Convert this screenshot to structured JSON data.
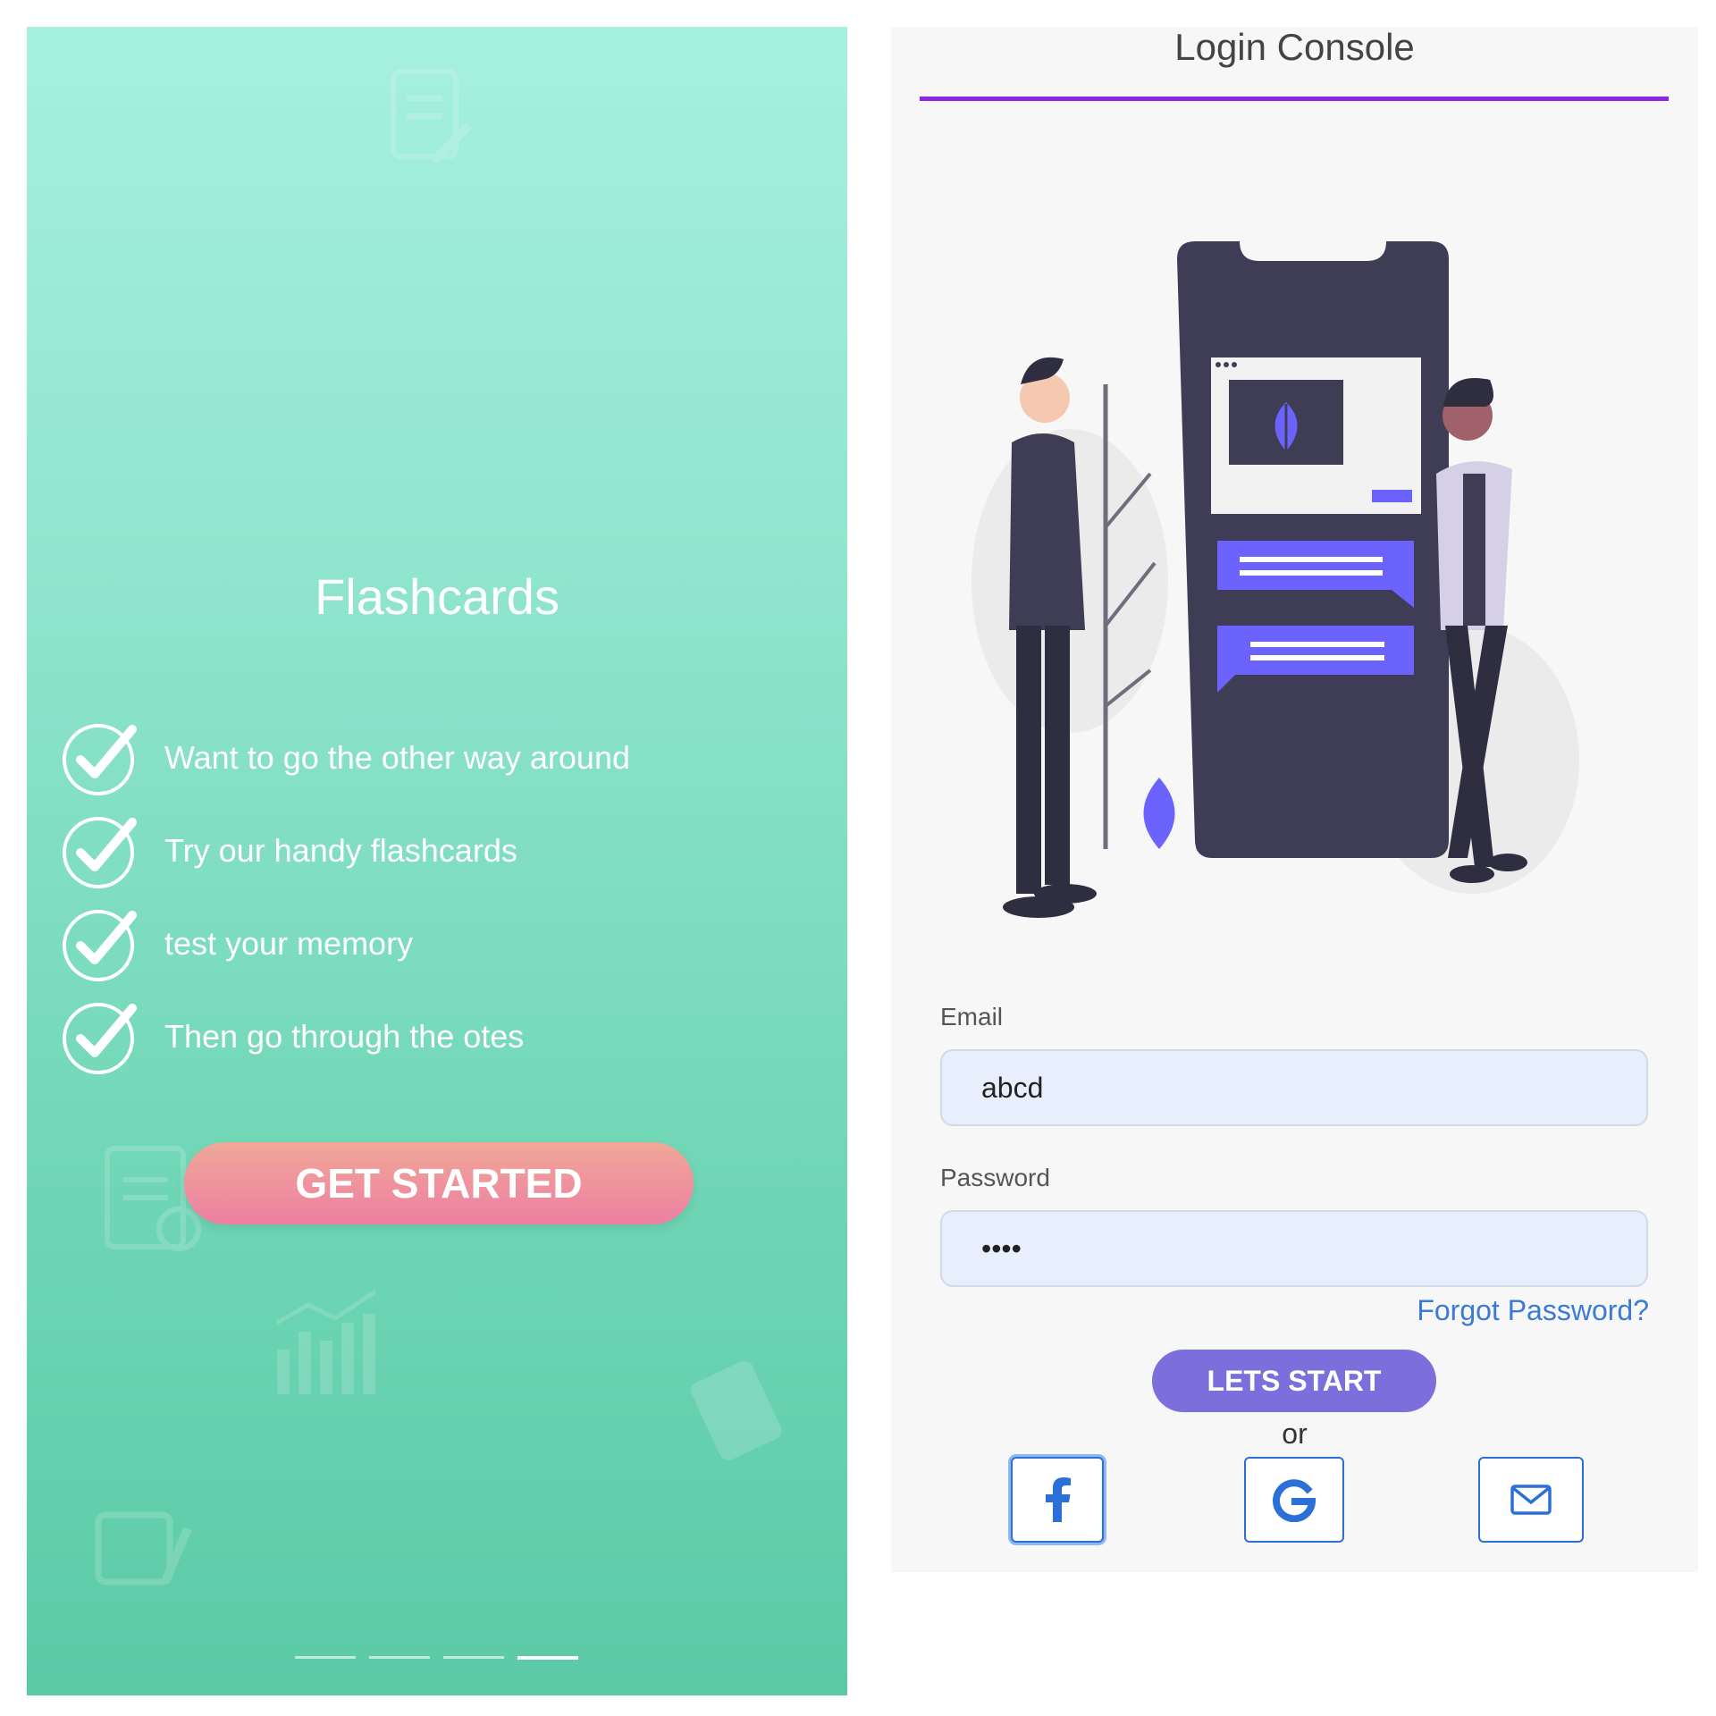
{
  "onboarding": {
    "title": "Flashcards",
    "features": [
      "Want to go the other way around",
      "Try our handy flashcards",
      "test your memory",
      "Then go through the otes"
    ],
    "cta_label": "GET STARTED",
    "pager_count": 4,
    "pager_active": 4
  },
  "login": {
    "title": "Login Console",
    "email_label": "Email",
    "email_value": "abcd",
    "password_label": "Password",
    "password_value": "abcd",
    "forgot_label": "Forgot Password?",
    "submit_label": "LETS START",
    "or_label": "or",
    "social": [
      {
        "icon": "facebook-icon"
      },
      {
        "icon": "google-icon"
      },
      {
        "icon": "mail-icon"
      }
    ]
  },
  "colors": {
    "panel_gradient_top": "#a6f0df",
    "panel_gradient_bottom": "#5ccaa6",
    "cta_gradient": "#ee7fa2",
    "underline": "#8e24e8",
    "submit": "#7c6fdc",
    "social_border": "#2b6fd8",
    "input_bg": "#e8effc",
    "illustration_dark": "#3f3d56",
    "illustration_accent": "#6c63ff"
  }
}
